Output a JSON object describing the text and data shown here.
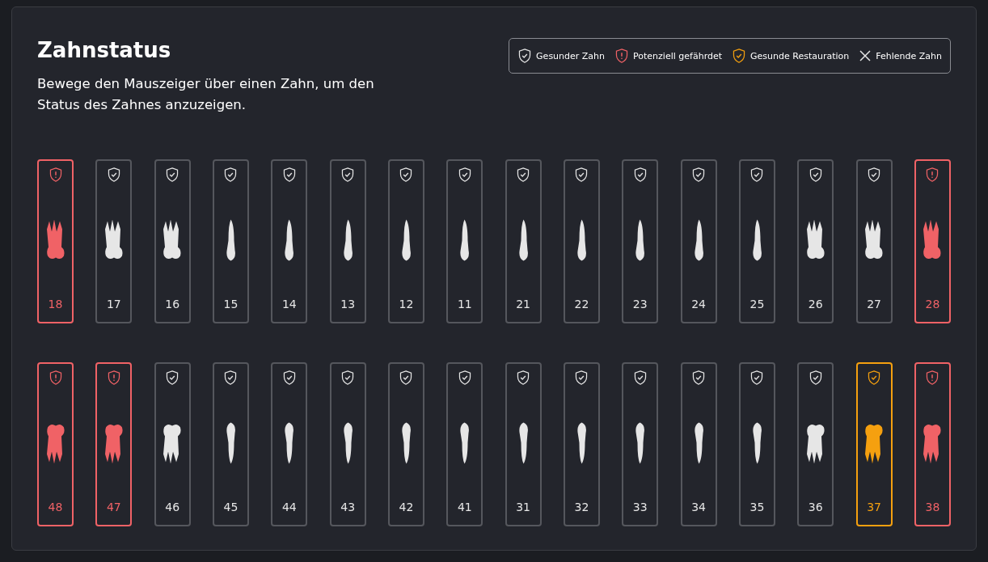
{
  "title": "Zahnstatus",
  "description": "Bewege den Mauszeiger über einen Zahn, um den Status des Zahnes anzuzeigen.",
  "legend": [
    {
      "kind": "healthy",
      "label": "Gesunder Zahn"
    },
    {
      "kind": "risk",
      "label": "Potenziell gefährdet"
    },
    {
      "kind": "restoration",
      "label": "Gesunde Restauration"
    },
    {
      "kind": "missing",
      "label": "Fehlende Zahn"
    }
  ],
  "upper_teeth": [
    {
      "number": "18",
      "kind": "risk",
      "multi_root": true
    },
    {
      "number": "17",
      "kind": "healthy",
      "multi_root": true
    },
    {
      "number": "16",
      "kind": "healthy",
      "multi_root": true
    },
    {
      "number": "15",
      "kind": "healthy",
      "multi_root": false
    },
    {
      "number": "14",
      "kind": "healthy",
      "multi_root": false
    },
    {
      "number": "13",
      "kind": "healthy",
      "multi_root": false
    },
    {
      "number": "12",
      "kind": "healthy",
      "multi_root": false
    },
    {
      "number": "11",
      "kind": "healthy",
      "multi_root": false
    },
    {
      "number": "21",
      "kind": "healthy",
      "multi_root": false
    },
    {
      "number": "22",
      "kind": "healthy",
      "multi_root": false
    },
    {
      "number": "23",
      "kind": "healthy",
      "multi_root": false
    },
    {
      "number": "24",
      "kind": "healthy",
      "multi_root": false
    },
    {
      "number": "25",
      "kind": "healthy",
      "multi_root": false
    },
    {
      "number": "26",
      "kind": "healthy",
      "multi_root": true
    },
    {
      "number": "27",
      "kind": "healthy",
      "multi_root": true
    },
    {
      "number": "28",
      "kind": "risk",
      "multi_root": true
    }
  ],
  "lower_teeth": [
    {
      "number": "48",
      "kind": "risk",
      "multi_root": true
    },
    {
      "number": "47",
      "kind": "risk",
      "multi_root": true
    },
    {
      "number": "46",
      "kind": "healthy",
      "multi_root": true
    },
    {
      "number": "45",
      "kind": "healthy",
      "multi_root": false
    },
    {
      "number": "44",
      "kind": "healthy",
      "multi_root": false
    },
    {
      "number": "43",
      "kind": "healthy",
      "multi_root": false
    },
    {
      "number": "42",
      "kind": "healthy",
      "multi_root": false
    },
    {
      "number": "41",
      "kind": "healthy",
      "multi_root": false
    },
    {
      "number": "31",
      "kind": "healthy",
      "multi_root": false
    },
    {
      "number": "32",
      "kind": "healthy",
      "multi_root": false
    },
    {
      "number": "33",
      "kind": "healthy",
      "multi_root": false
    },
    {
      "number": "34",
      "kind": "healthy",
      "multi_root": false
    },
    {
      "number": "35",
      "kind": "healthy",
      "multi_root": false
    },
    {
      "number": "36",
      "kind": "healthy",
      "multi_root": true
    },
    {
      "number": "37",
      "kind": "restoration",
      "multi_root": true
    },
    {
      "number": "38",
      "kind": "risk",
      "multi_root": true
    }
  ]
}
